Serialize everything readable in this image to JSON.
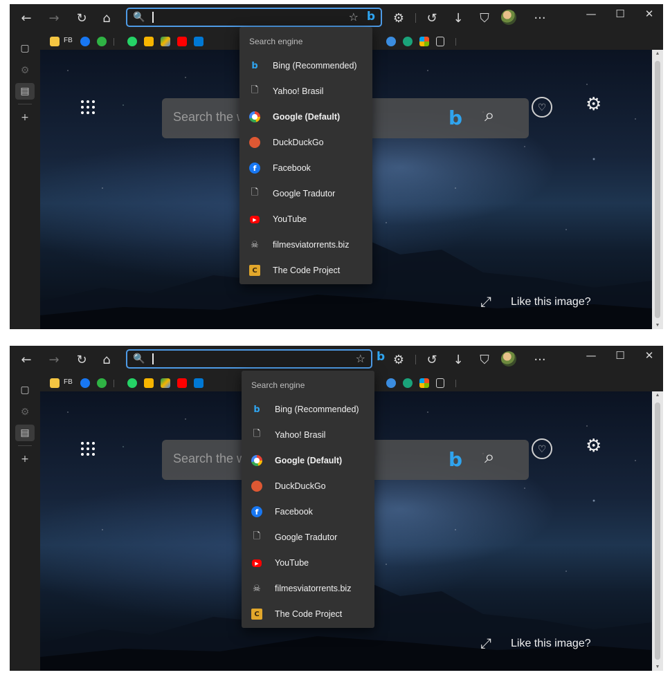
{
  "toolbar": {
    "back_icon": "←",
    "forward_icon": "→",
    "refresh_icon": "↻",
    "home_icon": "⌂",
    "search_glyph": "🔍",
    "favorite_icon": "☆",
    "bing_label": "b",
    "extensions_icon": "⚙",
    "history_icon": "↺",
    "download_icon": "↓",
    "shield_icon": "⛉",
    "more_icon": "···"
  },
  "window_controls": {
    "minimize": "—",
    "maximize": "☐",
    "close": "✕"
  },
  "favorites_bar": {
    "folder_label": "FB"
  },
  "rail": {
    "tabs_icon": "▢",
    "settings_icon": "⚙",
    "collections_icon": "▤",
    "add_icon": "+"
  },
  "content": {
    "search_placeholder": "Search the web",
    "bing_label": "b",
    "search_icon": "⌕",
    "rewards_icon": "♡",
    "settings_icon": "⚙",
    "expand_icon": "⤢",
    "like_image_text": "Like this image?"
  },
  "dropdown": {
    "header": "Search engine",
    "items": [
      {
        "label": "Bing (Recommended)",
        "icon": "bing-icon",
        "glyph": "b",
        "bold": false
      },
      {
        "label": "Yahoo! Brasil",
        "icon": "document-icon",
        "glyph": "🗋",
        "bold": false
      },
      {
        "label": "Google (Default)",
        "icon": "google-icon",
        "glyph": "",
        "bold": true
      },
      {
        "label": "DuckDuckGo",
        "icon": "duckduckgo-icon",
        "glyph": "",
        "bold": false
      },
      {
        "label": "Facebook",
        "icon": "facebook-icon",
        "glyph": "f",
        "bold": false
      },
      {
        "label": "Google Tradutor",
        "icon": "document-icon",
        "glyph": "🗋",
        "bold": false
      },
      {
        "label": "YouTube",
        "icon": "youtube-icon",
        "glyph": "▶",
        "bold": false
      },
      {
        "label": "filmesviatorrents.biz",
        "icon": "skull-icon",
        "glyph": "☠",
        "bold": false
      },
      {
        "label": "The Code Project",
        "icon": "codeproject-icon",
        "glyph": "C",
        "bold": false
      }
    ]
  },
  "scrollbar": {
    "up": "▲",
    "down": "▼"
  },
  "colors": {
    "accent": "#4e9be6",
    "bing": "#2fa4ef",
    "dropdown_bg": "#323232",
    "chrome_bg": "#202020"
  }
}
